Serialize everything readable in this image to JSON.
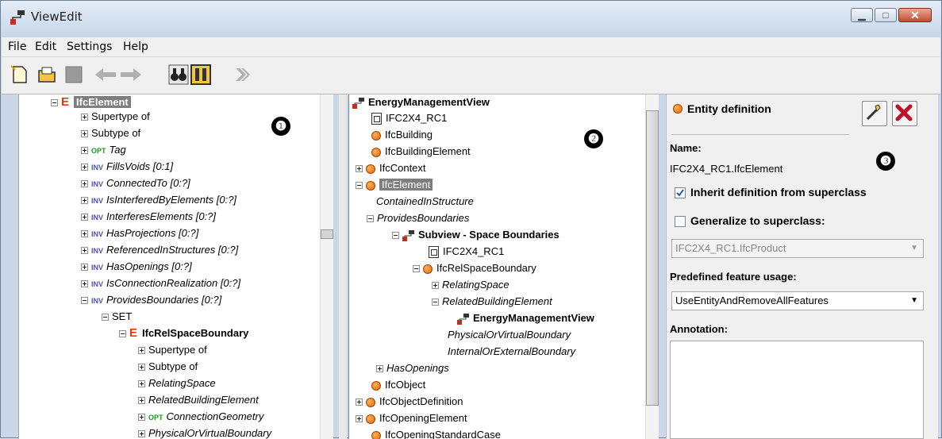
{
  "window": {
    "title": "ViewEdit"
  },
  "menu": [
    "File",
    "Edit",
    "Settings",
    "Help"
  ],
  "toolbar": {
    "icons": [
      "new-file-icon",
      "open-folder-icon",
      "save-icon",
      "back-arrow-icon",
      "forward-arrow-icon",
      "binoculars-icon",
      "split-view-icon",
      "chevron-forward-icon"
    ]
  },
  "callouts": [
    "❶",
    "❷",
    "❸"
  ],
  "left_tree": [
    {
      "text": "IfcElement",
      "kind": "entity-selected"
    },
    {
      "text": "Supertype of"
    },
    {
      "text": "Subtype of"
    },
    {
      "tag": "OPT",
      "text": "Tag"
    },
    {
      "tag": "INV",
      "text": "FillsVoids [0:1]"
    },
    {
      "tag": "INV",
      "text": "ConnectedTo [0:?]"
    },
    {
      "tag": "INV",
      "text": "IsInterferedByElements [0:?]"
    },
    {
      "tag": "INV",
      "text": "InterferesElements [0:?]"
    },
    {
      "tag": "INV",
      "text": "HasProjections [0:?]"
    },
    {
      "tag": "INV",
      "text": "ReferencedInStructures [0:?]"
    },
    {
      "tag": "INV",
      "text": "HasOpenings [0:?]"
    },
    {
      "tag": "INV",
      "text": "IsConnectionRealization [0:?]"
    },
    {
      "tag": "INV",
      "text": "ProvidesBoundaries [0:?]"
    },
    {
      "text": "SET"
    },
    {
      "text": "IfcRelSpaceBoundary",
      "kind": "entity"
    },
    {
      "text": "Supertype of"
    },
    {
      "text": "Subtype of"
    },
    {
      "text": "RelatingSpace"
    },
    {
      "text": "RelatedBuildingElement"
    },
    {
      "tag": "OPT",
      "text": "ConnectionGeometry"
    },
    {
      "text": "PhysicalOrVirtualBoundary"
    }
  ],
  "mid_tree": [
    {
      "text": "EnergyManagementView"
    },
    {
      "text": "IFC2X4_RC1"
    },
    {
      "text": "IfcBuilding"
    },
    {
      "text": "IfcBuildingElement"
    },
    {
      "text": "IfcContext"
    },
    {
      "text": "IfcElement"
    },
    {
      "text": "ContainedInStructure"
    },
    {
      "text": "ProvidesBoundaries"
    },
    {
      "text": "Subview - Space Boundaries"
    },
    {
      "text": "IFC2X4_RC1"
    },
    {
      "text": "IfcRelSpaceBoundary"
    },
    {
      "text": "RelatingSpace"
    },
    {
      "text": "RelatedBuildingElement"
    },
    {
      "text": "EnergyManagementView"
    },
    {
      "text": "PhysicalOrVirtualBoundary"
    },
    {
      "text": "InternalOrExternalBoundary"
    },
    {
      "text": "HasOpenings"
    },
    {
      "text": "IfcObject"
    },
    {
      "text": "IfcObjectDefinition"
    },
    {
      "text": "IfcOpeningElement"
    },
    {
      "text": "IfcOpeningStandardCase"
    }
  ],
  "detail": {
    "header": "Entity definition",
    "name_label": "Name:",
    "name_value": "IFC2X4_RC1.IfcElement",
    "inherit_label": "Inherit definition from superclass",
    "inherit_checked": true,
    "generalize_label": "Generalize to superclass:",
    "generalize_checked": false,
    "superclass_value": "IFC2X4_RC1.IfcProduct",
    "predefined_label": "Predefined feature usage:",
    "predefined_value": "UseEntityAndRemoveAllFeatures",
    "annotation_label": "Annotation:",
    "annotation_value": ""
  }
}
